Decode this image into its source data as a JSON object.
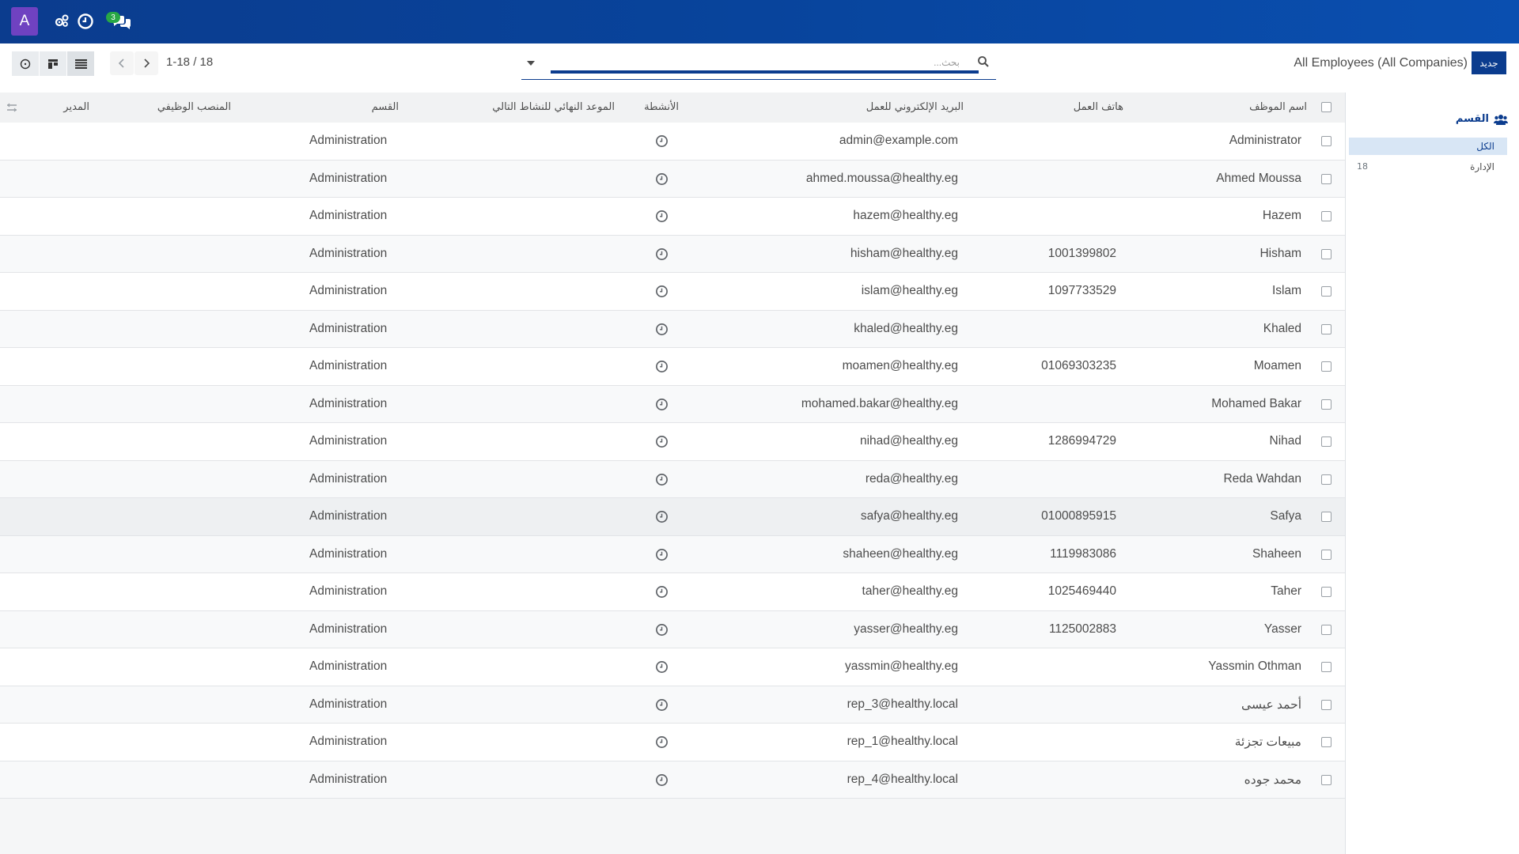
{
  "navbar": {
    "avatar_letter": "A",
    "chat_badge": "3",
    "icons": [
      "settings-gears-icon",
      "clock-icon",
      "chat-icon"
    ],
    "colors": {
      "navbar": "#0b3c8e",
      "avatar": "#6f42c1",
      "badge": "#28a745"
    }
  },
  "control": {
    "new_button": "جديد",
    "title": "All Employees (All Companies)",
    "search_placeholder": "بحث...",
    "pager": "1-18 / 18"
  },
  "table": {
    "headers": {
      "name": "اسم الموظف",
      "phone": "هاتف العمل",
      "email": "البريد الإلكتروني للعمل",
      "activities": "الأنشطة",
      "deadline": "الموعد النهائي للنشاط التالي",
      "department": "القسم",
      "job": "المنصب الوظيفي",
      "manager": "المدير"
    },
    "rows": [
      {
        "name": "Administrator",
        "phone": "",
        "email": "admin@example.com",
        "department": "Administration"
      },
      {
        "name": "Ahmed Moussa",
        "phone": "",
        "email": "ahmed.moussa@healthy.eg",
        "department": "Administration"
      },
      {
        "name": "Hazem",
        "phone": "",
        "email": "hazem@healthy.eg",
        "department": "Administration"
      },
      {
        "name": "Hisham",
        "phone": "1001399802",
        "email": "hisham@healthy.eg",
        "department": "Administration"
      },
      {
        "name": "Islam",
        "phone": "1097733529",
        "email": "islam@healthy.eg",
        "department": "Administration"
      },
      {
        "name": "Khaled",
        "phone": "",
        "email": "khaled@healthy.eg",
        "department": "Administration"
      },
      {
        "name": "Moamen",
        "phone": "01069303235",
        "email": "moamen@healthy.eg",
        "department": "Administration"
      },
      {
        "name": "Mohamed Bakar",
        "phone": "",
        "email": "mohamed.bakar@healthy.eg",
        "department": "Administration"
      },
      {
        "name": "Nihad",
        "phone": "1286994729",
        "email": "nihad@healthy.eg",
        "department": "Administration"
      },
      {
        "name": "Reda Wahdan",
        "phone": "",
        "email": "reda@healthy.eg",
        "department": "Administration"
      },
      {
        "name": "Safya",
        "phone": "01000895915",
        "email": "safya@healthy.eg",
        "department": "Administration"
      },
      {
        "name": "Shaheen",
        "phone": "1119983086",
        "email": "shaheen@healthy.eg",
        "department": "Administration"
      },
      {
        "name": "Taher",
        "phone": "1025469440",
        "email": "taher@healthy.eg",
        "department": "Administration"
      },
      {
        "name": "Yasser",
        "phone": "1125002883",
        "email": "yasser@healthy.eg",
        "department": "Administration"
      },
      {
        "name": "Yassmin Othman",
        "phone": "",
        "email": "yassmin@healthy.eg",
        "department": "Administration"
      },
      {
        "name": "أحمد عيسى",
        "phone": "",
        "email": "rep_3@healthy.local",
        "department": "Administration"
      },
      {
        "name": "مبيعات تجزئة",
        "phone": "",
        "email": "rep_1@healthy.local",
        "department": "Administration"
      },
      {
        "name": "محمد جوده",
        "phone": "",
        "email": "rep_4@healthy.local",
        "department": "Administration"
      }
    ]
  },
  "side": {
    "title": "القسم",
    "all_label": "الكل",
    "dept_label": "الإدارة",
    "dept_count": "18"
  }
}
